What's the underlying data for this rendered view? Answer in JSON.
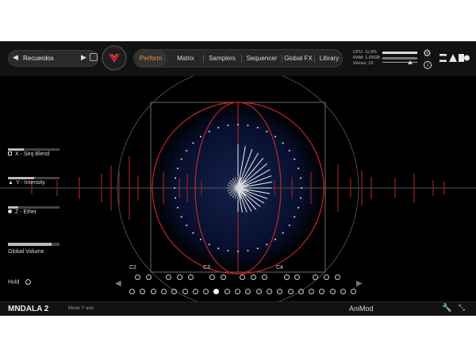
{
  "preset": {
    "name": "Recuerdos",
    "prev": "◀",
    "next": "▶"
  },
  "tabs": [
    "Perform",
    "Matrix",
    "Samplers",
    "Sequencer",
    "Global FX",
    "Library"
  ],
  "active_tab": "Perform",
  "stats": {
    "cpu": "CPU: 11.0%",
    "ram": "RAM: 1.09GB",
    "voices": "Voices: 10"
  },
  "controls": {
    "x_label": "X - Seq Blend",
    "y_label": "Y - Intensity",
    "z_label": "Z - Ether",
    "volume_label": "Global Volume",
    "volume_level": 0.85,
    "hold_label": "Hold"
  },
  "notes": [
    "C2",
    "C3",
    "C4"
  ],
  "footer": {
    "product": "MNDALA 2",
    "hint": "Move Y axis",
    "company": "AniMod"
  },
  "colors": {
    "accent": "#e69c3a",
    "ring": "#c0262b",
    "background": "#000000"
  },
  "icons": {
    "settings": "gear-icon",
    "info": "info-icon",
    "save": "save-icon",
    "wrench": "wrench-icon",
    "resize": "resize-icon"
  }
}
